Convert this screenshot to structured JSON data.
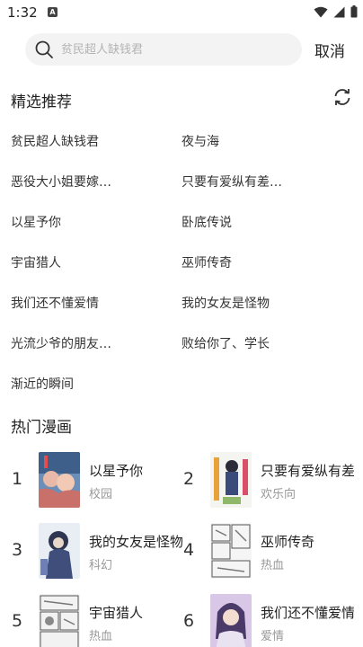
{
  "status_bar": {
    "time": "1:32",
    "app_icon_letter": "A"
  },
  "search": {
    "placeholder": "贫民超人缺钱君",
    "value": "",
    "cancel_label": "取消"
  },
  "recommend": {
    "title": "精选推荐",
    "items": [
      "贫民超人缺钱君",
      "夜与海",
      "恶役大小姐要嫁…",
      "只要有爱纵有差…",
      "以星予你",
      "卧底传说",
      "宇宙猎人",
      "巫师传奇",
      "我们还不懂爱情",
      "我的女友是怪物",
      "光流少爷的朋友…",
      "败给你了、学长",
      "渐近的瞬间"
    ]
  },
  "hot": {
    "title": "热门漫画",
    "items": [
      {
        "rank": "1",
        "title": "以星予你",
        "tag": "校园"
      },
      {
        "rank": "2",
        "title": "只要有爱纵有差",
        "tag": "欢乐向"
      },
      {
        "rank": "3",
        "title": "我的女友是怪物",
        "tag": "科幻"
      },
      {
        "rank": "4",
        "title": "巫师传奇",
        "tag": "热血"
      },
      {
        "rank": "5",
        "title": "宇宙猎人",
        "tag": "热血"
      },
      {
        "rank": "6",
        "title": "我们还不懂爱情",
        "tag": "爱情"
      }
    ]
  }
}
